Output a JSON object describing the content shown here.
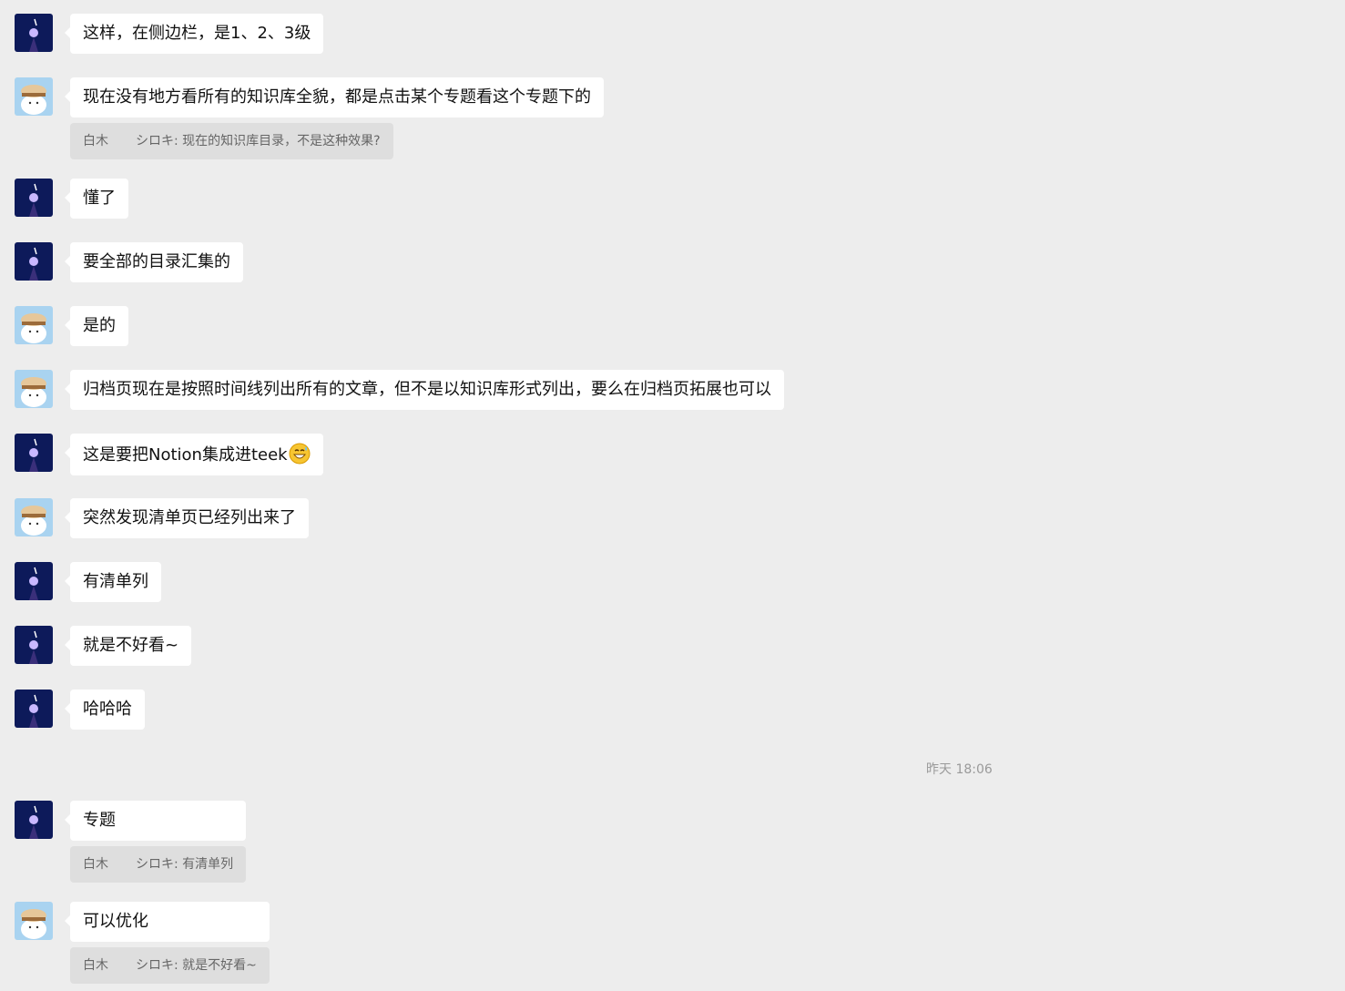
{
  "messages": [
    {
      "sender": "shiroki",
      "text": "这样，在侧边栏，是1、2、3级"
    },
    {
      "sender": "baimu",
      "text": "现在没有地方看所有的知识库全貌，都是点击某个专题看这个专题下的",
      "quote": {
        "name": "白木",
        "text": "シロキ: 现在的知识库目录，不是这种效果?"
      }
    },
    {
      "sender": "shiroki",
      "text": "懂了"
    },
    {
      "sender": "shiroki",
      "text": "要全部的目录汇集的"
    },
    {
      "sender": "baimu",
      "text": "是的"
    },
    {
      "sender": "baimu",
      "text": "归档页现在是按照时间线列出所有的文章，但不是以知识库形式列出，要么在归档页拓展也可以"
    },
    {
      "sender": "shiroki",
      "text": "这是要把Notion集成进teek",
      "emoji": "grinning-sweat-emoji"
    },
    {
      "sender": "baimu",
      "text": "突然发现清单页已经列出来了"
    },
    {
      "sender": "shiroki",
      "text": "有清单列"
    },
    {
      "sender": "shiroki",
      "text": "就是不好看~"
    },
    {
      "sender": "shiroki",
      "text": "哈哈哈"
    },
    {
      "sender": "shiroki",
      "text": "专题",
      "quote": {
        "name": "白木",
        "text": "シロキ: 有清单列"
      }
    },
    {
      "sender": "baimu",
      "text": "可以优化",
      "quote": {
        "name": "白木",
        "text": "シロキ: 就是不好看~"
      }
    }
  ],
  "timestamp": "昨天 18:06",
  "colors": {
    "background": "#ededed",
    "bubble": "#ffffff",
    "quote_bg": "#dedede",
    "shiroki_avatar": "#0d1a5a",
    "baimu_avatar": "#a9d3f0"
  }
}
